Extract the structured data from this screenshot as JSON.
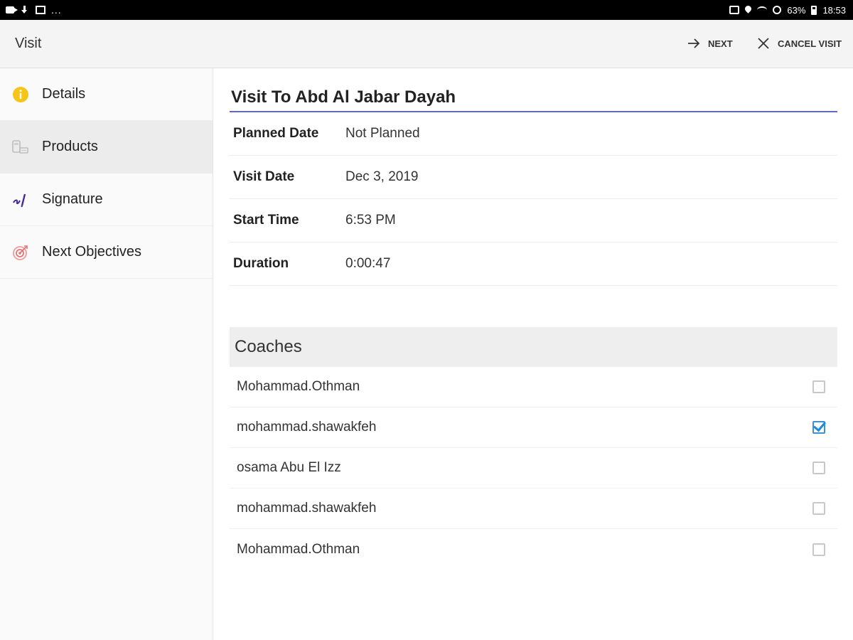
{
  "status_bar": {
    "left_icons": [
      "video-icon",
      "download-icon",
      "image-icon"
    ],
    "more": "...",
    "battery": "63%",
    "time": "18:53",
    "right_icons": [
      "nfc-icon",
      "location-icon",
      "wifi-icon",
      "dnd-icon",
      "battery-icon"
    ]
  },
  "toolbar": {
    "title": "Visit",
    "next_label": "NEXT",
    "cancel_label": "CANCEL VISIT"
  },
  "sidebar": {
    "items": [
      {
        "label": "Details",
        "icon": "info-icon",
        "active": false
      },
      {
        "label": "Products",
        "icon": "products-icon",
        "active": true
      },
      {
        "label": "Signature",
        "icon": "signature-icon",
        "active": false
      },
      {
        "label": "Next Objectives",
        "icon": "target-icon",
        "active": false
      }
    ]
  },
  "main": {
    "title": "Visit To Abd Al Jabar Dayah",
    "details": [
      {
        "label": "Planned Date",
        "value": "Not Planned"
      },
      {
        "label": "Visit Date",
        "value": "Dec 3, 2019"
      },
      {
        "label": "Start Time",
        "value": "6:53 PM"
      },
      {
        "label": "Duration",
        "value": "0:00:47"
      }
    ],
    "coaches_header": "Coaches",
    "coaches": [
      {
        "name": "Mohammad.Othman",
        "checked": false
      },
      {
        "name": "mohammad.shawakfeh",
        "checked": true
      },
      {
        "name": "osama Abu El Izz",
        "checked": false
      },
      {
        "name": "mohammad.shawakfeh",
        "checked": false
      },
      {
        "name": "Mohammad.Othman",
        "checked": false
      }
    ]
  },
  "colors": {
    "accent_underline": "#5c6bc0",
    "checkbox_checked": "#1e88e5",
    "info_icon": "#f5c518",
    "signature_icon": "#4527a0",
    "target_icon": "#e57373"
  }
}
